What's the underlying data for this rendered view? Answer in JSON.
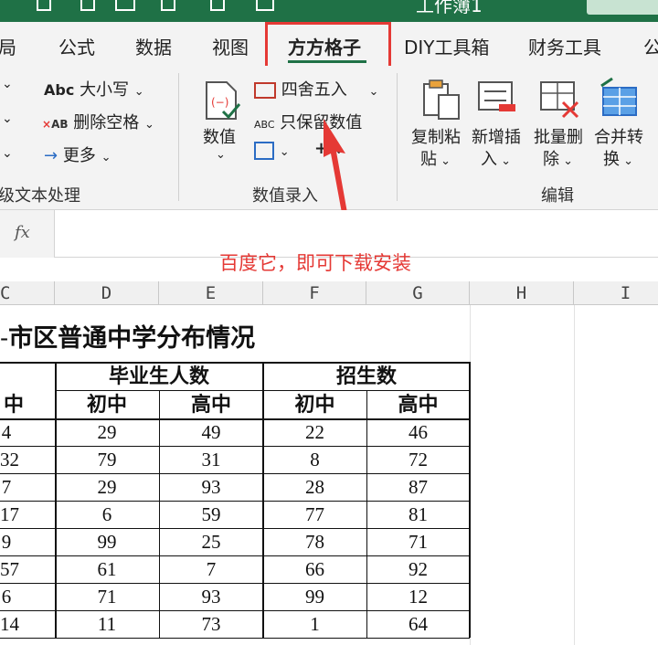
{
  "window": {
    "title_fragment": "工作簿1"
  },
  "tabs": [
    "局",
    "公式",
    "数据",
    "视图",
    "DIY工具箱",
    "财务工具",
    "公"
  ],
  "active_tab": "方方格子",
  "ribbon": {
    "text_group": {
      "items": [
        "大小写",
        "删除空格",
        "更多"
      ],
      "label": "级文本处理"
    },
    "number_group": {
      "big_button": "数值",
      "items": [
        "四舍五入",
        "只保留数值"
      ],
      "label": "数值录入"
    },
    "edit_group": {
      "buttons": [
        {
          "line1": "复制粘",
          "line2": "贴"
        },
        {
          "line1": "新增插",
          "line2": "入"
        },
        {
          "line1": "批量删",
          "line2": "除"
        },
        {
          "line1": "合并转",
          "line2": "换"
        }
      ],
      "label": "编辑"
    },
    "icon_labels": {
      "abc": "Abc",
      "ab": "AB",
      "abc2": "ABC"
    }
  },
  "formula_bar": {
    "fx": "fx",
    "value": ""
  },
  "annotation": "百度它，即可下载安装",
  "columns": [
    "C",
    "D",
    "E",
    "F",
    "G",
    "H",
    "I"
  ],
  "sheet": {
    "title": "市区普通中学分布情况",
    "group_headers": [
      "毕业生人数",
      "招生数"
    ],
    "sub_headers": [
      "中",
      "初中",
      "高中",
      "初中",
      "高中"
    ],
    "rows": [
      [
        "4",
        "29",
        "49",
        "22",
        "46"
      ],
      [
        "32",
        "79",
        "31",
        "8",
        "72"
      ],
      [
        "7",
        "29",
        "93",
        "28",
        "87"
      ],
      [
        "17",
        "6",
        "59",
        "77",
        "81"
      ],
      [
        "9",
        "99",
        "25",
        "78",
        "71"
      ],
      [
        "57",
        "61",
        "7",
        "66",
        "92"
      ],
      [
        "6",
        "71",
        "93",
        "99",
        "12"
      ],
      [
        "14",
        "11",
        "73",
        "1",
        "64"
      ]
    ]
  }
}
